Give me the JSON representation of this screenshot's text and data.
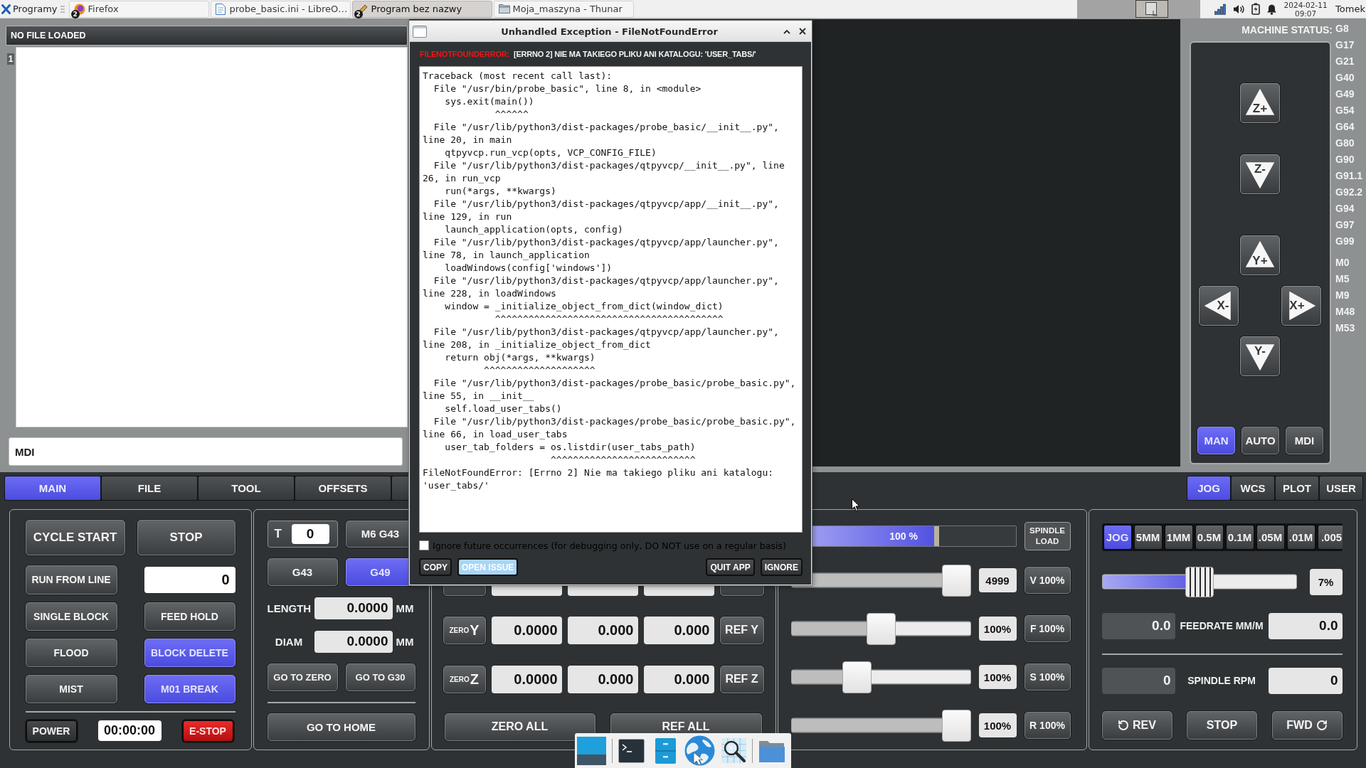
{
  "taskbar": {
    "start": "Programy",
    "tasks": [
      {
        "label": "Firefox",
        "kind": "browser",
        "badge": "2",
        "selected": false
      },
      {
        "label": "probe_basic.ini - LibreO…",
        "kind": "document",
        "selected": false
      },
      {
        "label": "Program bez nazwy",
        "kind": "app",
        "badge": "2",
        "selected": true
      },
      {
        "label": "Moja_maszyna - Thunar",
        "kind": "folder",
        "selected": false
      }
    ],
    "date": "2024-02-11",
    "time": "09:07",
    "user": "Tomek"
  },
  "file_header": "NO FILE LOADED",
  "gcode_view": {
    "line_numbers": [
      "1"
    ]
  },
  "mdi": {
    "placeholder": "MDI"
  },
  "machine_status": {
    "label": "MACHINE STATUS:",
    "g_codes": [
      "G8",
      "G17",
      "G21",
      "G40",
      "G49",
      "G54",
      "G64",
      "G80",
      "G90",
      "G91.1",
      "G92.2",
      "G94",
      "G97",
      "G99"
    ],
    "m_codes": [
      "M0",
      "M5",
      "M9",
      "M48",
      "M53"
    ]
  },
  "jog_pad": {
    "buttons": [
      {
        "label": "Z+",
        "kind": "up"
      },
      {
        "label": "Z-",
        "kind": "down"
      },
      {
        "label": "Y+",
        "kind": "up"
      },
      {
        "label": "X-",
        "kind": "left"
      },
      {
        "label": "X+",
        "kind": "right"
      },
      {
        "label": "Y-",
        "kind": "down"
      }
    ],
    "modes": [
      {
        "label": "MAN",
        "selected": true
      },
      {
        "label": "AUTO",
        "selected": false
      },
      {
        "label": "MDI",
        "selected": false
      }
    ]
  },
  "main_tabs": [
    {
      "label": "MAIN",
      "selected": true
    },
    {
      "label": "FILE",
      "selected": false
    },
    {
      "label": "TOOL",
      "selected": false
    },
    {
      "label": "OFFSETS",
      "selected": false
    }
  ],
  "side_tabs": [
    {
      "label": "JOG",
      "selected": true
    },
    {
      "label": "WCS",
      "selected": false
    },
    {
      "label": "PLOT",
      "selected": false
    },
    {
      "label": "USER",
      "selected": false
    }
  ],
  "program_panel": {
    "cycle_start": "CYCLE START",
    "stop": "STOP",
    "run_from_line": {
      "label": "RUN FROM LINE",
      "value": "0"
    },
    "toggles": [
      {
        "label": "SINGLE BLOCK",
        "on": false
      },
      {
        "label": "FEED HOLD",
        "on": false
      },
      {
        "label": "FLOOD",
        "on": false
      },
      {
        "label": "BLOCK DELETE",
        "on": true
      },
      {
        "label": "MIST",
        "on": false
      },
      {
        "label": "M01 BREAK",
        "on": true
      }
    ],
    "power": {
      "label": "POWER",
      "on": false
    },
    "timer": "00:00:00",
    "estop": {
      "label": "E-STOP",
      "on": true
    }
  },
  "tool_panel": {
    "tool_label": "T",
    "tool_number": "0",
    "tool_change": "M6 G43",
    "offset_modes": [
      {
        "label": "G43",
        "selected": false
      },
      {
        "label": "G49",
        "selected": true
      }
    ],
    "fields": [
      {
        "label": "LENGTH",
        "value": "0.0000",
        "unit": "MM"
      },
      {
        "label": "DIAM",
        "value": "0.0000",
        "unit": "MM"
      }
    ],
    "go_to_zero": "GO TO ZERO",
    "go_to_g30": "GO TO G30",
    "go_to_home": "GO TO HOME"
  },
  "dro_panel": {
    "rows": [
      {
        "zero": "ZERO",
        "axis": "Y",
        "values": [
          "0.0000",
          "0.000",
          "0.000"
        ],
        "ref": "REF Y"
      },
      {
        "zero": "ZERO",
        "axis": "Z",
        "values": [
          "0.0000",
          "0.000",
          "0.000"
        ],
        "ref": "REF Z"
      }
    ],
    "zero_all": "ZERO ALL",
    "ref_all": "REF ALL"
  },
  "override_panel": {
    "spindle_load": {
      "level": 0.66,
      "reading": "100 %",
      "label": "SPINDLE LOAD"
    },
    "sliders": [
      {
        "level": 1,
        "reading": "4999",
        "button": "V 100%"
      },
      {
        "level": 0.5,
        "reading": "100%",
        "button": "F 100%"
      },
      {
        "level": 0.34,
        "reading": "100%",
        "button": "S 100%"
      },
      {
        "level": 1,
        "reading": "100%",
        "button": "R 100%"
      }
    ]
  },
  "jog_panel": {
    "increments": [
      {
        "label": "JOG",
        "selected": true
      },
      {
        "label": "5MM",
        "selected": false
      },
      {
        "label": "1MM",
        "selected": false
      },
      {
        "label": "0.5M",
        "selected": false
      },
      {
        "label": "0.1M",
        "selected": false
      },
      {
        "label": ".05M",
        "selected": false
      },
      {
        "label": ".01M",
        "selected": false
      },
      {
        "label": ".005",
        "selected": false
      }
    ],
    "speed": {
      "level": 0.5,
      "reading": "7%"
    },
    "readouts": [
      {
        "label": "FEEDRATE MM/M",
        "actual": "0.0",
        "commanded": "0.0"
      },
      {
        "label": "SPINDLE RPM",
        "actual": "0",
        "commanded": "0"
      }
    ],
    "spindle_buttons": [
      {
        "label": "REV",
        "kind": "rev"
      },
      {
        "label": "STOP",
        "kind": "stop"
      },
      {
        "label": "FWD",
        "kind": "fwd"
      }
    ]
  },
  "dialog": {
    "title": "Unhandled Exception - FileNotFoundError",
    "error_type": "FILENOTFOUNDERROR:",
    "error_message": "[ERRNO 2] NIE MA TAKIEGO PLIKU ANI KATALOGU: 'USER_TABS/'",
    "traceback": "Traceback (most recent call last):\n  File \"/usr/bin/probe_basic\", line 8, in <module>\n    sys.exit(main())\n             ^^^^^^\n  File \"/usr/lib/python3/dist-packages/probe_basic/__init__.py\",\nline 20, in main\n    qtpyvcp.run_vcp(opts, VCP_CONFIG_FILE)\n  File \"/usr/lib/python3/dist-packages/qtpyvcp/__init__.py\", line\n26, in run_vcp\n    run(*args, **kwargs)\n  File \"/usr/lib/python3/dist-packages/qtpyvcp/app/__init__.py\",\nline 129, in run\n    launch_application(opts, config)\n  File \"/usr/lib/python3/dist-packages/qtpyvcp/app/launcher.py\",\nline 78, in launch_application\n    loadWindows(config['windows'])\n  File \"/usr/lib/python3/dist-packages/qtpyvcp/app/launcher.py\",\nline 228, in loadWindows\n    window = _initialize_object_from_dict(window_dict)\n             ^^^^^^^^^^^^^^^^^^^^^^^^^^^^^^^^^^^^^^^^^\n  File \"/usr/lib/python3/dist-packages/qtpyvcp/app/launcher.py\",\nline 208, in _initialize_object_from_dict\n    return obj(*args, **kwargs)\n           ^^^^^^^^^^^^^^^^^^^^\n  File \"/usr/lib/python3/dist-packages/probe_basic/probe_basic.py\",\nline 55, in __init__\n    self.load_user_tabs()\n  File \"/usr/lib/python3/dist-packages/probe_basic/probe_basic.py\",\nline 66, in load_user_tabs\n    user_tab_folders = os.listdir(user_tabs_path)\n                       ^^^^^^^^^^^^^^^^^^^^^^^^^^\nFileNotFoundError: [Errno 2] Nie ma takiego pliku ani katalogu:\n'user_tabs/'",
    "ignore_option": {
      "label": "Ignore future occurrences (for debugging only, DO NOT use on a regular basis)",
      "checked": false
    },
    "left_buttons": [
      {
        "label": "COPY",
        "highlighted": false
      },
      {
        "label": "OPEN ISSUE",
        "highlighted": true
      }
    ],
    "right_buttons": [
      {
        "label": "QUIT APP",
        "highlighted": false
      },
      {
        "label": "IGNORE",
        "highlighted": false
      }
    ]
  }
}
